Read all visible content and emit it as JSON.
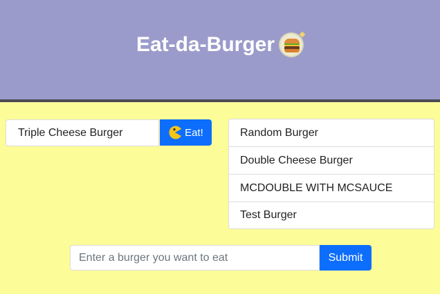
{
  "header": {
    "title": "Eat-da-Burger",
    "icon": "burger-icon",
    "background": "#9b9bcb"
  },
  "devoured": {
    "items": [
      {
        "name": "Triple Cheese Burger",
        "action_label": "Eat!",
        "action_icon": "pacman-icon"
      }
    ]
  },
  "burgers": {
    "items": [
      {
        "name": "Random Burger"
      },
      {
        "name": "Double Cheese Burger"
      },
      {
        "name": "MCDOUBLE WITH MCSAUCE"
      },
      {
        "name": "Test Burger"
      }
    ]
  },
  "form": {
    "placeholder": "Enter a burger you want to eat",
    "value": "",
    "submit_label": "Submit"
  },
  "colors": {
    "page_background": "#fcfc99",
    "accent": "#0d6efd"
  }
}
